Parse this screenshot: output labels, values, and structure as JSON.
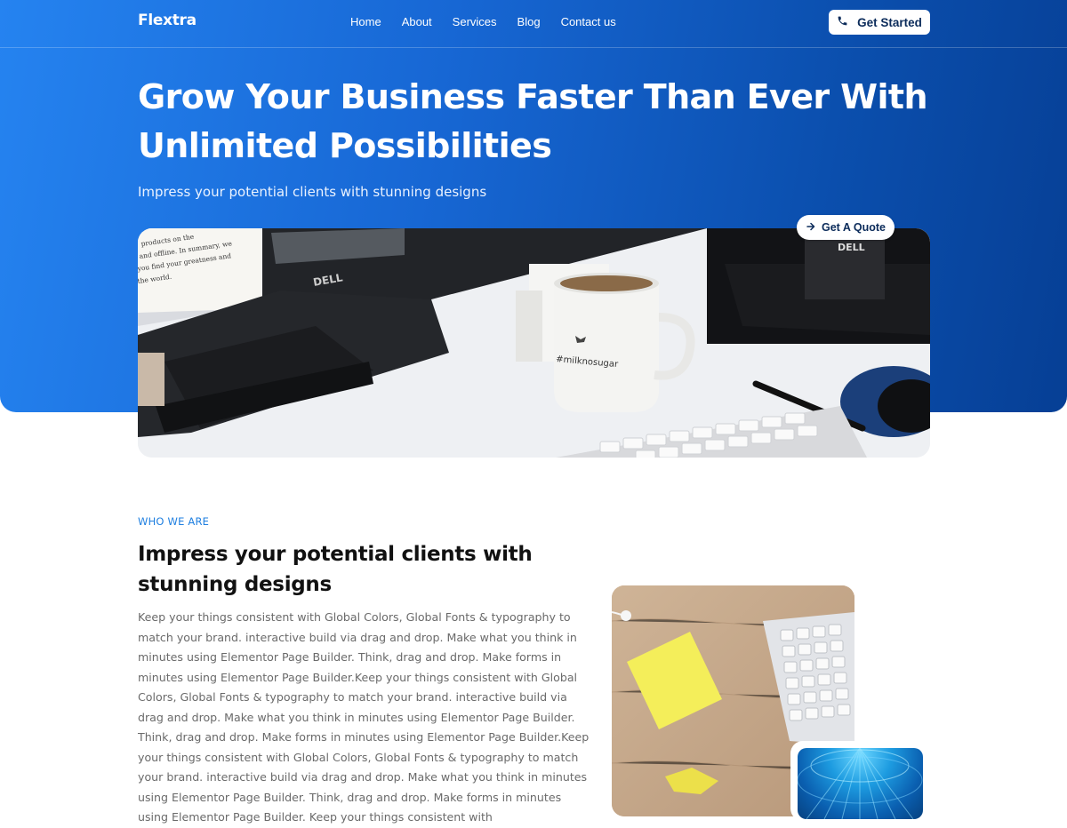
{
  "brand": {
    "name": "Flextra"
  },
  "nav": {
    "items": [
      "Home",
      "About",
      "Services",
      "Blog",
      "Contact us"
    ]
  },
  "header": {
    "cta_label": "Get Started",
    "cta_icon": "phone-icon"
  },
  "hero": {
    "title_line1": "Grow Your Business Faster Than Ever With",
    "title_line2": "Unlimited Possibilities",
    "subtitle": "Impress your potential clients with stunning designs",
    "quote_label": "Get A Quote",
    "quote_icon": "arrow-right-icon",
    "image_alt": "desk-with-monitors-and-coffee-mug",
    "mug_text": "#milknosugar",
    "monitor_brand": "DELL",
    "paper_text": [
      "products on the",
      "and offline. In summary, we",
      "you find your greatness and",
      "the world."
    ]
  },
  "about": {
    "eyebrow": "WHO WE ARE",
    "title": "Impress your potential clients with stunning designs",
    "body": "Keep your things consistent with Global Colors, Global Fonts & typography to match your brand. interactive build via drag and drop. Make what you think in minutes using Elementor Page Builder. Think, drag and drop. Make forms in minutes using Elementor Page Builder.Keep your things consistent with Global Colors, Global Fonts & typography to match your brand. interactive build via drag and drop. Make what you think in minutes using Elementor Page Builder. Think, drag and drop. Make forms in minutes using Elementor Page Builder.Keep your things consistent with Global Colors, Global Fonts & typography to match your brand. interactive build via drag and drop. Make what you think in minutes using Elementor Page Builder. Think, drag and drop. Make forms in minutes using Elementor Page Builder. Keep your things consistent with"
  },
  "colors": {
    "hero_start": "#2583f0",
    "hero_end": "#063f95",
    "accent": "#1f7fe0",
    "white": "#ffffff"
  }
}
